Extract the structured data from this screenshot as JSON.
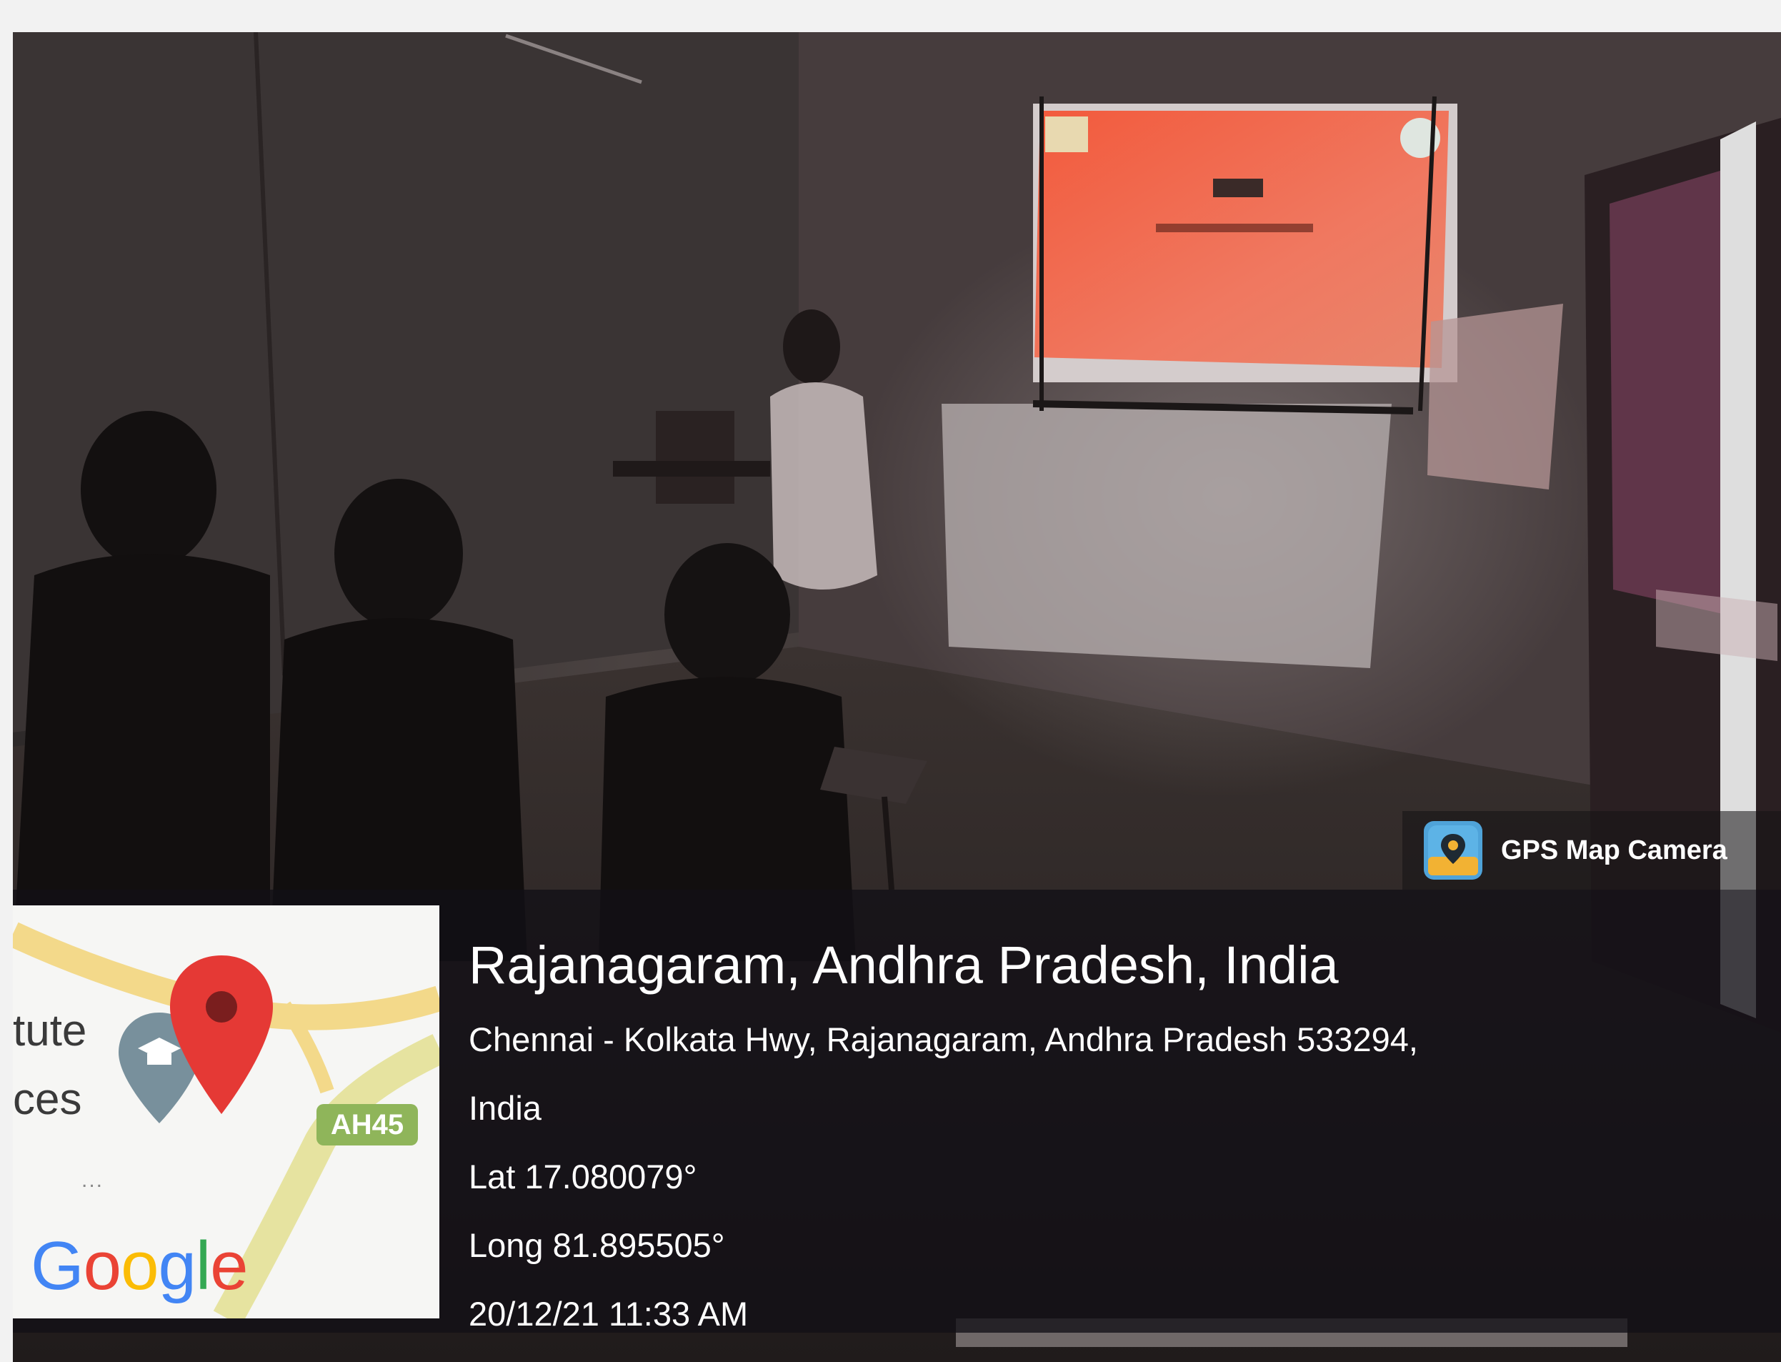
{
  "badge": {
    "app_name": "GPS Map Camera",
    "icon": "map-pin-icon",
    "icon_color": "#4fa3d9"
  },
  "map": {
    "label_line1": "tute",
    "label_line2": "ces",
    "ellipsis": "...",
    "road_shield": "AH45",
    "brand": "Google",
    "brand_colors": [
      "#4285F4",
      "#EA4335",
      "#FBBC05",
      "#4285F4",
      "#34A853",
      "#EA4335"
    ],
    "pin_color": "#e53935",
    "school_pin_color": "#78909c",
    "icons": [
      "location-pin-icon",
      "school-pin-icon"
    ]
  },
  "location": {
    "title": "Rajanagaram, Andhra Pradesh, India",
    "address_line1": "Chennai - Kolkata Hwy, Rajanagaram, Andhra Pradesh 533294,",
    "address_line2": "India",
    "latitude": "Lat 17.080079°",
    "longitude": "Long 81.895505°",
    "timestamp": "20/12/21 11:33 AM"
  }
}
